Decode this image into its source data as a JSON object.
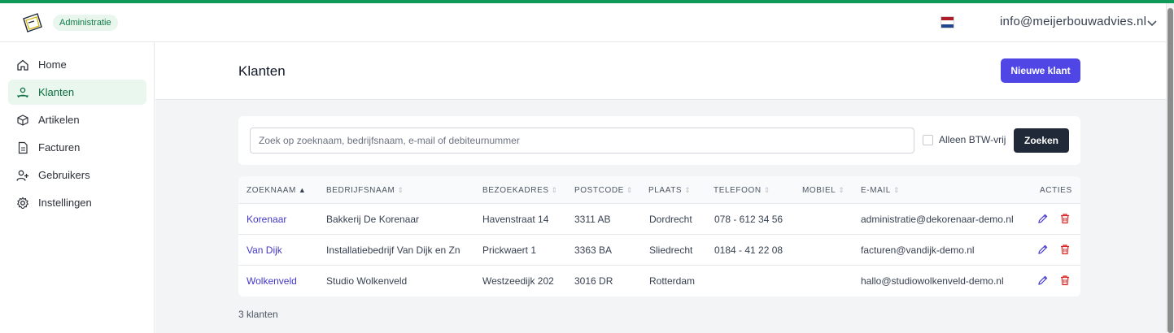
{
  "app": {
    "badge": "Administratie"
  },
  "header": {
    "user_email": "info@meijerbouwadvies.nl",
    "flag_colors": [
      "#ae1c28",
      "#ffffff",
      "#21468b"
    ]
  },
  "sidebar": {
    "items": [
      {
        "label": "Home",
        "icon": "home-icon"
      },
      {
        "label": "Klanten",
        "icon": "users-icon",
        "active": true
      },
      {
        "label": "Artikelen",
        "icon": "box-icon"
      },
      {
        "label": "Facturen",
        "icon": "document-icon"
      },
      {
        "label": "Gebruikers",
        "icon": "user-plus-icon"
      },
      {
        "label": "Instellingen",
        "icon": "gear-icon"
      }
    ]
  },
  "page": {
    "title": "Klanten",
    "new_button": "Nieuwe klant"
  },
  "search": {
    "placeholder": "Zoek op zoeknaam, bedrijfsnaam, e-mail of debiteurnummer",
    "value": "",
    "checkbox_label": "Alleen BTW-vrij",
    "checkbox_checked": false,
    "button": "Zoeken"
  },
  "table": {
    "headers": [
      "Zoeknaam",
      "Bedrijfsnaam",
      "Bezoekadres",
      "Postcode",
      "Plaats",
      "Telefoon",
      "Mobiel",
      "E-mail",
      "Acties"
    ],
    "rows": [
      {
        "zoeknaam": "Korenaar",
        "bedrijfsnaam": "Bakkerij De Korenaar",
        "bezoekadres": "Havenstraat 14",
        "postcode": "3311 AB",
        "plaats": "Dordrecht",
        "telefoon": "078 - 612 34 56",
        "mobiel": "",
        "email": "administratie@dekorenaar-demo.nl"
      },
      {
        "zoeknaam": "Van Dijk",
        "bedrijfsnaam": "Installatiebedrijf Van Dijk en Zn",
        "bezoekadres": "Prickwaert 1",
        "postcode": "3363 BA",
        "plaats": "Sliedrecht",
        "telefoon": "0184 - 41 22 08",
        "mobiel": "",
        "email": "facturen@vandijk-demo.nl"
      },
      {
        "zoeknaam": "Wolkenveld",
        "bedrijfsnaam": "Studio Wolkenveld",
        "bezoekadres": "Westzeedijk 202",
        "postcode": "3016 DR",
        "plaats": "Rotterdam",
        "telefoon": "",
        "mobiel": "",
        "email": "hallo@studiowolkenveld-demo.nl"
      }
    ],
    "count_label": "3 klanten"
  },
  "colors": {
    "accent": "#4f46e5",
    "brand_green": "#0f9a5a",
    "delete_red": "#dc2626"
  }
}
